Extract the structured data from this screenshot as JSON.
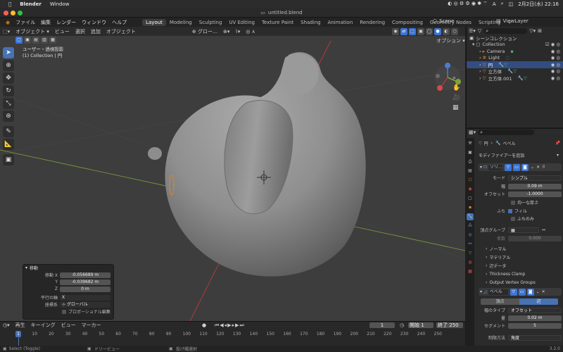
{
  "macbar": {
    "app": "Blender",
    "window": "Window",
    "clock": "2月2日(水) 22:16"
  },
  "window": {
    "title": "untitled.blend"
  },
  "topmenu": [
    "ファイル",
    "編集",
    "レンダー",
    "ウィンドウ",
    "ヘルプ"
  ],
  "workspaces": [
    "Layout",
    "Modeling",
    "Sculpting",
    "UV Editing",
    "Texture Paint",
    "Shading",
    "Animation",
    "Rendering",
    "Compositing",
    "Geometry Nodes",
    "Scripting"
  ],
  "scene": {
    "name": "Scene",
    "view_layer": "ViewLayer"
  },
  "viewport": {
    "mode": "オブジェクト",
    "menus": [
      "ビュー",
      "選択",
      "追加",
      "オブジェクト"
    ],
    "transform": "グロー…",
    "options": "オプション",
    "info_line1": "ユーザー・透視投影",
    "info_line2": "(1) Collection | 円"
  },
  "op_panel": {
    "title": "移動",
    "fields": [
      {
        "label": "移動 X",
        "value": "-0.056689 m"
      },
      {
        "label": "Y",
        "value": "-0.039682 m"
      },
      {
        "label": "Z",
        "value": "0 m"
      }
    ],
    "axis_label": "平行の軸",
    "axis_value": "X",
    "orient_label": "座標系",
    "orient_value": "グローバル",
    "prop_edit": "プロポーショナル編集"
  },
  "timeline": {
    "menus": [
      "再生",
      "キーイング",
      "ビュー",
      "マーカー"
    ],
    "current_frame": "1",
    "start_label": "開始",
    "start": "1",
    "end_label": "終了",
    "end": "250",
    "ticks": [
      "0",
      "10",
      "20",
      "30",
      "40",
      "50",
      "60",
      "70",
      "80",
      "90",
      "100",
      "110",
      "120",
      "130",
      "140",
      "150",
      "160",
      "170",
      "180",
      "190",
      "200",
      "210",
      "220",
      "230",
      "240",
      "250"
    ]
  },
  "statusbar": {
    "left": "Select (Toggle)",
    "mid": "ドリービュー",
    "right": "投げ縄選択",
    "version": "3.2.0"
  },
  "outliner": {
    "root": "シーンコレクション",
    "collection": "Collection",
    "items": [
      "Camera",
      "Light",
      "円",
      "立方体",
      "立方体.001"
    ]
  },
  "properties": {
    "object_name": "円",
    "modifier_name": "ベベル",
    "add_modifier": "モディファイアーを追加",
    "mod1": {
      "name": "ソリ…",
      "mode_label": "モード",
      "mode": "シンプル",
      "width_label": "幅",
      "width": "0.09 m",
      "offset_label": "オフセット",
      "offset": "-1.0000",
      "even": "均一な厚さ",
      "rim_label": "ふち",
      "fill": "フィル",
      "rim_only": "ふちのみ",
      "vgroup_label": "頂点グループ",
      "factor_label": "係数",
      "factor": "0.000",
      "subpanels": [
        "ノーマル",
        "マテリアル",
        "辺データ",
        "Thickness Clamp",
        "Output Vertex Groups"
      ]
    },
    "mod2": {
      "name": "ベベル",
      "tab_vertex": "頂点",
      "tab_edge": "辺",
      "width_type_label": "幅のタイプ",
      "width_type": "オフセット",
      "amount_label": "量",
      "amount": "0.02 m",
      "segments_label": "セグメント",
      "segments": "5",
      "limit_label": "制限方法",
      "limit": "角度"
    }
  },
  "colors": {
    "accent": "#4772b3",
    "viewport_bg": "#3d3d3d",
    "x_axis": "#b03a3a",
    "y_axis": "#7fa33a",
    "selected_orange": "#e08a2a"
  }
}
